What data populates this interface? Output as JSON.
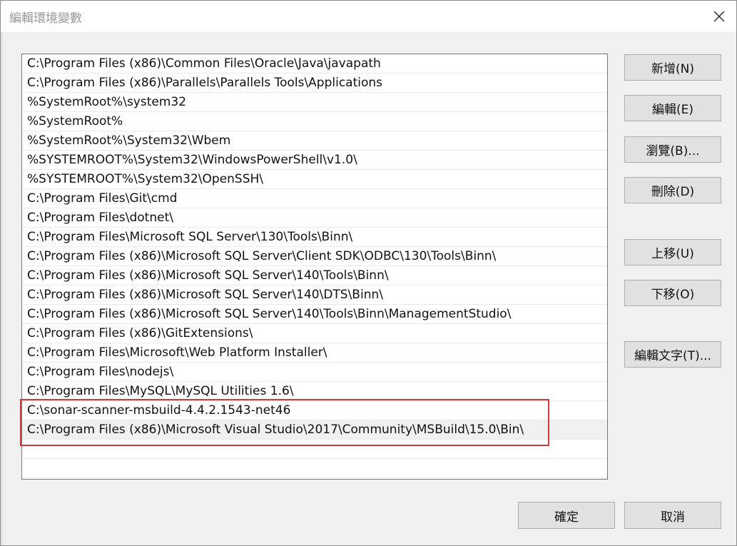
{
  "window": {
    "title": "編輯環境變數"
  },
  "path_list": {
    "items": [
      "C:\\Program Files (x86)\\Common Files\\Oracle\\Java\\javapath",
      "C:\\Program Files (x86)\\Parallels\\Parallels Tools\\Applications",
      "%SystemRoot%\\system32",
      "%SystemRoot%",
      "%SystemRoot%\\System32\\Wbem",
      "%SYSTEMROOT%\\System32\\WindowsPowerShell\\v1.0\\",
      "%SYSTEMROOT%\\System32\\OpenSSH\\",
      "C:\\Program Files\\Git\\cmd",
      "C:\\Program Files\\dotnet\\",
      "C:\\Program Files\\Microsoft SQL Server\\130\\Tools\\Binn\\",
      "C:\\Program Files (x86)\\Microsoft SQL Server\\Client SDK\\ODBC\\130\\Tools\\Binn\\",
      "C:\\Program Files (x86)\\Microsoft SQL Server\\140\\Tools\\Binn\\",
      "C:\\Program Files (x86)\\Microsoft SQL Server\\140\\DTS\\Binn\\",
      "C:\\Program Files (x86)\\Microsoft SQL Server\\140\\Tools\\Binn\\ManagementStudio\\",
      "C:\\Program Files (x86)\\GitExtensions\\",
      "C:\\Program Files\\Microsoft\\Web Platform Installer\\",
      "C:\\Program Files\\nodejs\\",
      "C:\\Program Files\\MySQL\\MySQL Utilities 1.6\\",
      "C:\\sonar-scanner-msbuild-4.4.2.1543-net46",
      "C:\\Program Files (x86)\\Microsoft Visual Studio\\2017\\Community\\MSBuild\\15.0\\Bin\\"
    ],
    "selected_index": 19
  },
  "buttons": {
    "new": "新增(N)",
    "edit": "編輯(E)",
    "browse": "瀏覽(B)...",
    "delete": "刪除(D)",
    "move_up": "上移(U)",
    "move_down": "下移(O)",
    "edit_text": "編輯文字(T)...",
    "ok": "確定",
    "cancel": "取消"
  },
  "colors": {
    "highlight_border": "#d9363e",
    "selected_row": "#f0f0f0"
  }
}
